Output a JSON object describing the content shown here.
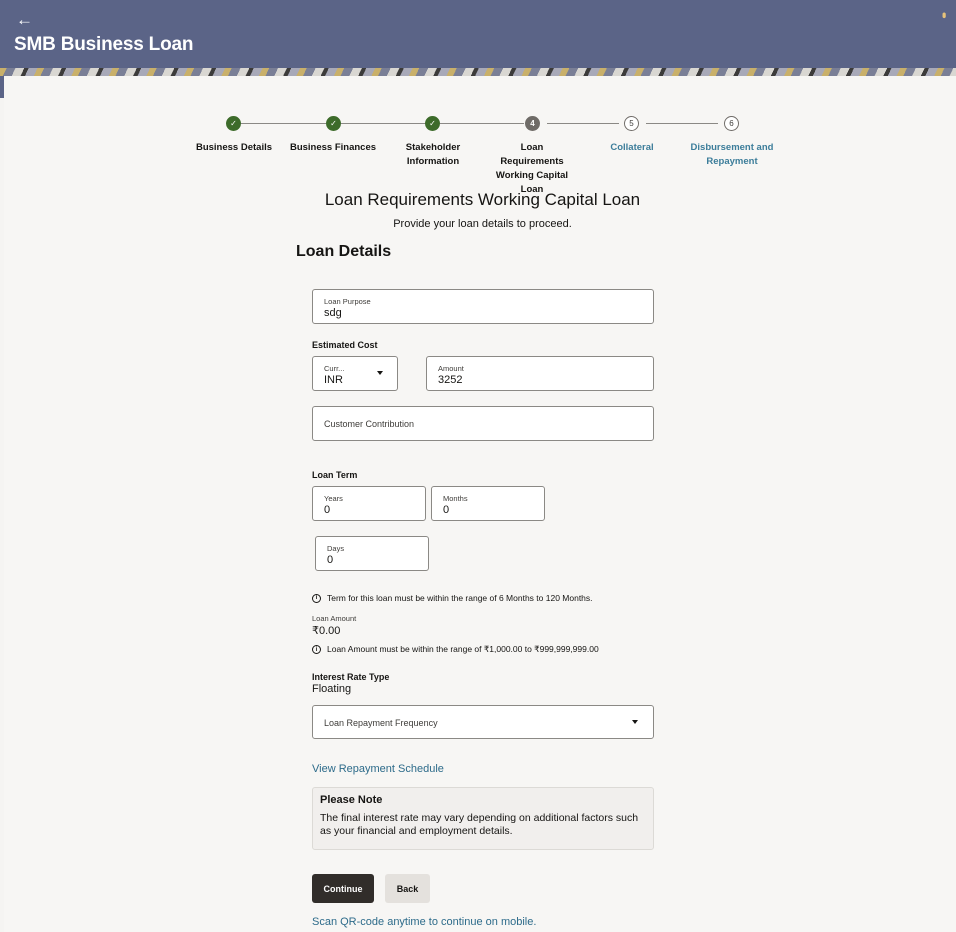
{
  "header": {
    "back_icon": "arrow-left-icon",
    "title": "SMB Business Loan",
    "menu_icon": "kebab-menu-icon"
  },
  "stepper": {
    "steps": [
      {
        "label": "Business Details",
        "status": "done",
        "marker": "✓"
      },
      {
        "label": "Business Finances",
        "status": "done",
        "marker": "✓"
      },
      {
        "label": "Stakeholder Information",
        "status": "done",
        "marker": "✓"
      },
      {
        "label": "Loan Requirements Working Capital Loan",
        "status": "current",
        "marker": "4"
      },
      {
        "label": "Collateral",
        "status": "pending",
        "marker": "5"
      },
      {
        "label": "Disbursement and Repayment",
        "status": "pending",
        "marker": "6"
      }
    ]
  },
  "page": {
    "title": "Loan Requirements Working Capital Loan",
    "subtitle": "Provide your loan details to proceed.",
    "section_title": "Loan Details"
  },
  "form": {
    "loan_purpose": {
      "label": "Loan Purpose",
      "value": "sdg"
    },
    "estimated_cost_label": "Estimated Cost",
    "currency": {
      "label": "Curr...",
      "value": "INR"
    },
    "amount": {
      "label": "Amount",
      "value": "3252"
    },
    "customer_contribution": {
      "placeholder": "Customer Contribution"
    },
    "loan_term_label": "Loan Term",
    "years": {
      "label": "Years",
      "value": "0"
    },
    "months": {
      "label": "Months",
      "value": "0"
    },
    "days": {
      "label": "Days",
      "value": "0"
    },
    "term_info": "Term for this loan must be within the range of 6 Months to 120 Months.",
    "loan_amount_label": "Loan Amount",
    "loan_amount_value": "₹0.00",
    "loan_amount_info": "Loan Amount must be within the range of ₹1,000.00 to ₹999,999,999.00",
    "interest_rate_type_label": "Interest Rate Type",
    "interest_rate_type_value": "Floating",
    "repayment_frequency": {
      "placeholder": "Loan Repayment Frequency"
    },
    "view_schedule_link": "View Repayment Schedule"
  },
  "note": {
    "title": "Please Note",
    "body": "The final interest rate may vary depending on additional factors such as your financial and employment details."
  },
  "actions": {
    "continue_label": "Continue",
    "back_label": "Back",
    "qr_link": "Scan QR-code anytime to continue on mobile."
  },
  "colors": {
    "header_bg": "#5b6487",
    "step_done": "#3d6b2a",
    "link": "#2d6b8a",
    "primary_button": "#312d2a"
  }
}
